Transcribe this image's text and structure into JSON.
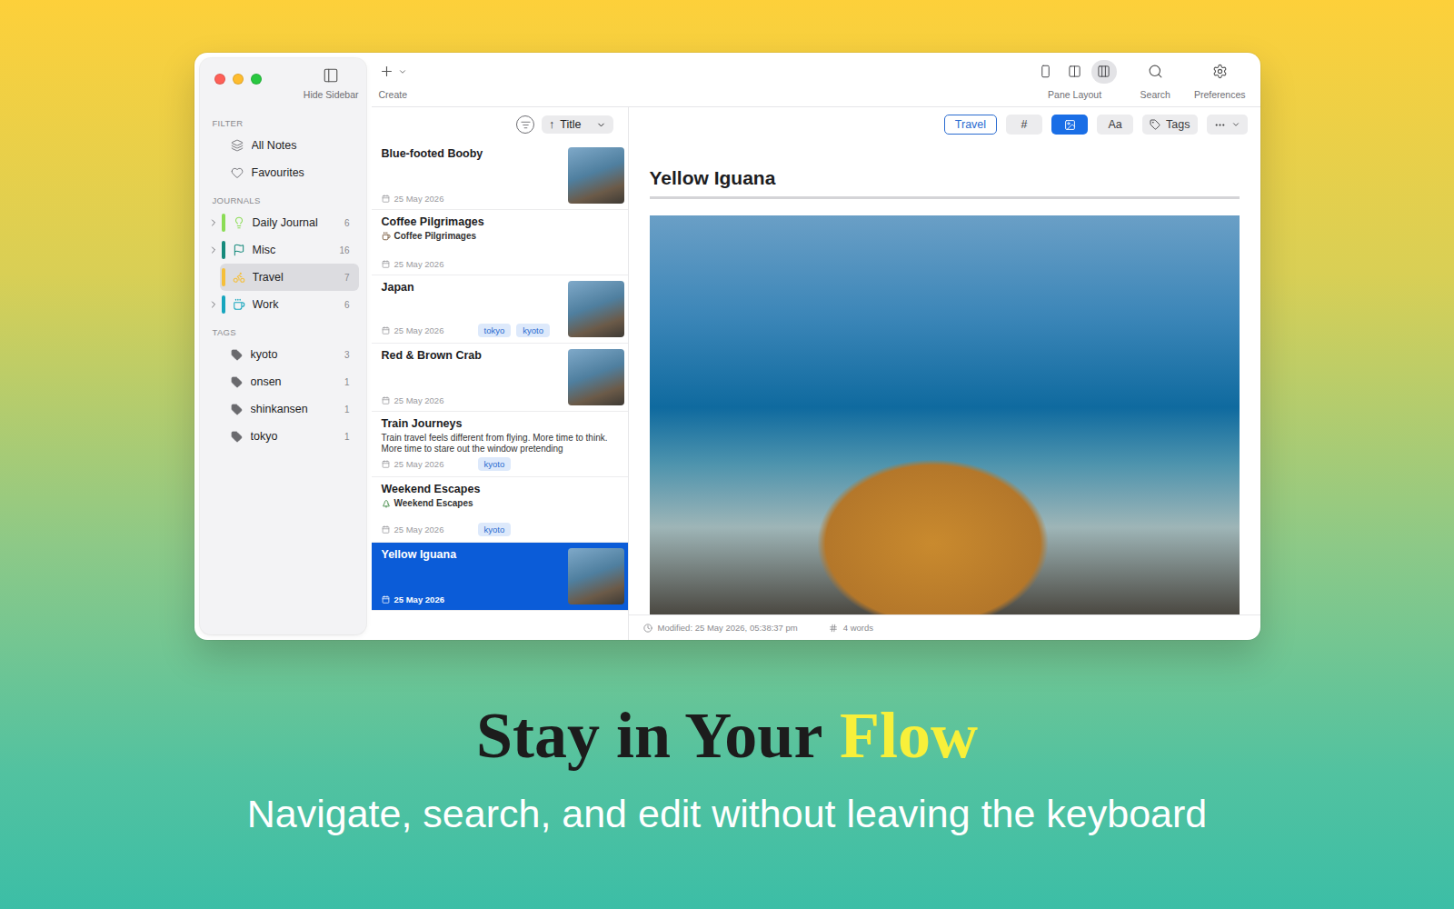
{
  "toolbar": {
    "hide_sidebar": "Hide Sidebar",
    "create": "Create",
    "pane_layout": {
      "label": "Pane Layout",
      "options": [
        {
          "selected": false
        },
        {
          "selected": false
        },
        {
          "selected": true
        }
      ]
    },
    "search": "Search",
    "preferences": "Preferences"
  },
  "filter": {
    "heading": "FILTER",
    "items": [
      {
        "label": "All Notes",
        "selected": false
      },
      {
        "label": "Favourites",
        "selected": false
      }
    ]
  },
  "journals": {
    "heading": "JOURNALS",
    "items": [
      {
        "name": "Daily Journal",
        "count": "6",
        "color": "#8bdc55",
        "expandable": true,
        "selected": false
      },
      {
        "name": "Misc",
        "count": "16",
        "color": "#168a7c",
        "expandable": true,
        "selected": false
      },
      {
        "name": "Travel",
        "count": "7",
        "color": "#f5bf3a",
        "expandable": false,
        "selected": true
      },
      {
        "name": "Work",
        "count": "6",
        "color": "#17a6be",
        "expandable": true,
        "selected": false
      }
    ]
  },
  "tags": {
    "heading": "TAGS",
    "items": [
      {
        "name": "kyoto",
        "count": "3"
      },
      {
        "name": "onsen",
        "count": "1"
      },
      {
        "name": "shinkansen",
        "count": "1"
      },
      {
        "name": "tokyo",
        "count": "1"
      }
    ]
  },
  "list": {
    "sort": {
      "direction": "↑",
      "label": "Title"
    },
    "notes": [
      {
        "title": "Blue-footed Booby",
        "subtitle": null,
        "preview": null,
        "date": "25 May 2026",
        "tags": [],
        "image": true,
        "selected": false
      },
      {
        "title": "Coffee Pilgrimages",
        "subtitle": {
          "kind": "coffee",
          "text": "Coffee Pilgrimages"
        },
        "preview": null,
        "date": "25 May 2026",
        "tags": [],
        "image": false,
        "selected": false
      },
      {
        "title": "Japan",
        "subtitle": null,
        "preview": null,
        "date": "25 May 2026",
        "tags": [
          "tokyo",
          "kyoto"
        ],
        "image": true,
        "selected": false
      },
      {
        "title": "Red & Brown Crab",
        "subtitle": null,
        "preview": null,
        "date": "25 May 2026",
        "tags": [],
        "image": true,
        "selected": false
      },
      {
        "title": "Train Journeys",
        "subtitle": null,
        "preview": "Train travel feels different from flying. More time to think. More time to stare out the window pretending",
        "date": "25 May 2026",
        "tags": [
          "kyoto"
        ],
        "image": false,
        "selected": false
      },
      {
        "title": "Weekend Escapes",
        "subtitle": {
          "kind": "tree",
          "text": "Weekend Escapes"
        },
        "preview": null,
        "date": "25 May 2026",
        "tags": [
          "kyoto"
        ],
        "image": false,
        "selected": false
      },
      {
        "title": "Yellow Iguana",
        "subtitle": null,
        "preview": null,
        "date": "25 May 2026",
        "tags": [],
        "image": true,
        "selected": true
      }
    ]
  },
  "editor": {
    "toolbar": [
      {
        "kind": "journal",
        "label": "Travel",
        "selected": false
      },
      {
        "kind": "toggle",
        "label": "#",
        "selected": false
      },
      {
        "kind": "image-toggle",
        "label": "",
        "selected": true
      },
      {
        "kind": "toggle",
        "label": "Aa",
        "selected": false
      },
      {
        "kind": "tags",
        "label": "Tags",
        "selected": false
      },
      {
        "kind": "menu",
        "label": "",
        "selected": false
      }
    ],
    "title": "Yellow Iguana",
    "image": true,
    "footer": {
      "modified": "Modified: 25 May 2026, 05:38:37 pm",
      "words": "4 words"
    }
  },
  "hero": {
    "title": "Stay in Your",
    "highlight": "Flow",
    "subtitle": "Navigate, search, and edit without leaving the keyboard"
  }
}
